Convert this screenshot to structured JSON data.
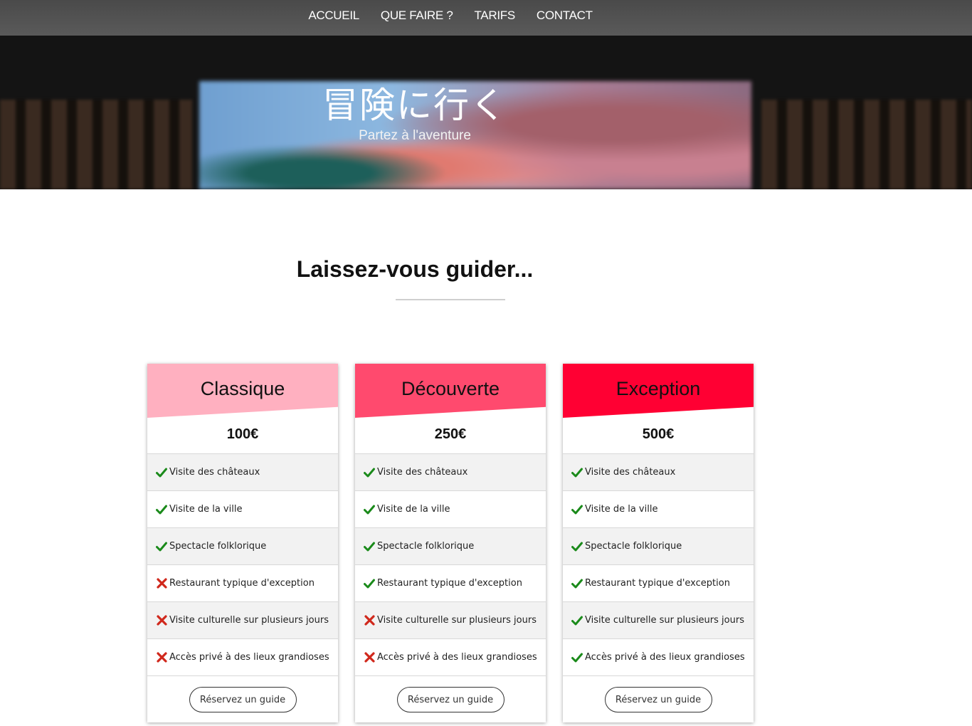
{
  "nav": {
    "items": [
      "ACCUEIL",
      "QUE FAIRE ?",
      "TARIFS",
      "CONTACT"
    ]
  },
  "hero": {
    "title": "冒険に行く",
    "subtitle": "Partez à l'aventure"
  },
  "section": {
    "heading": "Laissez-vous guider..."
  },
  "colors": {
    "classique": "#ffb0c0",
    "decouverte": "#ff4a6e",
    "exception": "#ff0033",
    "check": "#1a8a1a",
    "cross": "#d0281c"
  },
  "icons": {
    "included": "check-icon",
    "excluded": "cross-icon"
  },
  "plans": [
    {
      "name": "Classique",
      "price": "100€",
      "features": [
        {
          "label": "Visite des châteaux",
          "included": true
        },
        {
          "label": "Visite de la ville",
          "included": true
        },
        {
          "label": "Spectacle folklorique",
          "included": true
        },
        {
          "label": "Restaurant typique d'exception",
          "included": false
        },
        {
          "label": "Visite culturelle sur plusieurs jours",
          "included": false
        },
        {
          "label": "Accès privé à des lieux grandioses",
          "included": false
        }
      ],
      "button": "Réservez un guide"
    },
    {
      "name": "Découverte",
      "price": "250€",
      "features": [
        {
          "label": "Visite des châteaux",
          "included": true
        },
        {
          "label": "Visite de la ville",
          "included": true
        },
        {
          "label": "Spectacle folklorique",
          "included": true
        },
        {
          "label": "Restaurant typique d'exception",
          "included": true
        },
        {
          "label": "Visite culturelle sur plusieurs jours",
          "included": false
        },
        {
          "label": "Accès privé à des lieux grandioses",
          "included": false
        }
      ],
      "button": "Réservez un guide"
    },
    {
      "name": "Exception",
      "price": "500€",
      "features": [
        {
          "label": "Visite des châteaux",
          "included": true
        },
        {
          "label": "Visite de la ville",
          "included": true
        },
        {
          "label": "Spectacle folklorique",
          "included": true
        },
        {
          "label": "Restaurant typique d'exception",
          "included": true
        },
        {
          "label": "Visite culturelle sur plusieurs jours",
          "included": true
        },
        {
          "label": "Accès privé à des lieux grandioses",
          "included": true
        }
      ],
      "button": "Réservez un guide"
    }
  ]
}
